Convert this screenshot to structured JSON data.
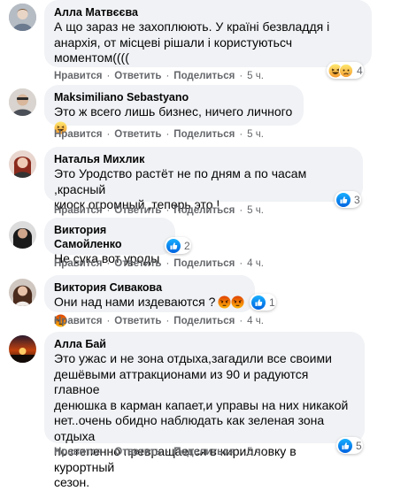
{
  "comments": [
    {
      "author": "Алла Матвєєва",
      "text": "А що зараз не захоплюють. У країні безвладдя і\nанархія, от місцеві рішали і користуютьсч\nмоментом((((",
      "actions": {
        "like": "Нравится",
        "reply": "Ответить",
        "share": "Поделиться",
        "time": "5 ч."
      },
      "reactions": {
        "count": "4",
        "icons": [
          "haha-icon",
          "sad-icon"
        ]
      }
    },
    {
      "author": "Maksimiliano Sebastyano",
      "text": "Это ж всего лишь бизнес, ничего личного",
      "actions": {
        "like": "Нравится",
        "reply": "Ответить",
        "share": "Поделиться",
        "time": "5 ч."
      }
    },
    {
      "author": "Наталья Михлик",
      "text": "Это Уродство растёт не по дням а по часам ,красный\nкиоск огромный ,теперь это !",
      "actions": {
        "like": "Нравится",
        "reply": "Ответить",
        "share": "Поделиться",
        "time": "5 ч."
      },
      "reactions": {
        "count": "3",
        "icons": [
          "like-icon"
        ]
      }
    },
    {
      "author": "Виктория Самойленко",
      "text": "Не сука вот уроды",
      "actions": {
        "like": "Нравится",
        "reply": "Ответить",
        "share": "Поделиться",
        "time": "4 ч."
      },
      "reactions": {
        "count": "2",
        "icons": [
          "like-icon"
        ]
      }
    },
    {
      "author": "Виктория Сивакова",
      "text": "Они над нами издеваются ?",
      "actions": {
        "like": "Нравится",
        "reply": "Ответить",
        "share": "Поделиться",
        "time": "4 ч."
      },
      "reactions": {
        "count": "1",
        "icons": [
          "like-icon"
        ]
      }
    },
    {
      "author": "Алла Бай",
      "text": "Это ужас и не зона отдыха,загадили все своими\nдешёвыми аттракционами из 90 и радуются главное\nденюшка в карман капает,и управы на них никакой\nнет..очень обидно наблюдать как зеленая зона отдыха\nпостепенно превращается в кирилловку в курортный\nсезон.",
      "actions": {
        "like": "Нравится",
        "reply": "Ответить",
        "share": "Поделиться",
        "time": "5 ч."
      },
      "reactions": {
        "count": "5",
        "icons": [
          "like-icon"
        ]
      }
    }
  ],
  "colors": {
    "bubble": "#f0f2f5",
    "meta": "#65676b",
    "like_blue": "#1877f2",
    "angry_red": "#e9710f"
  }
}
